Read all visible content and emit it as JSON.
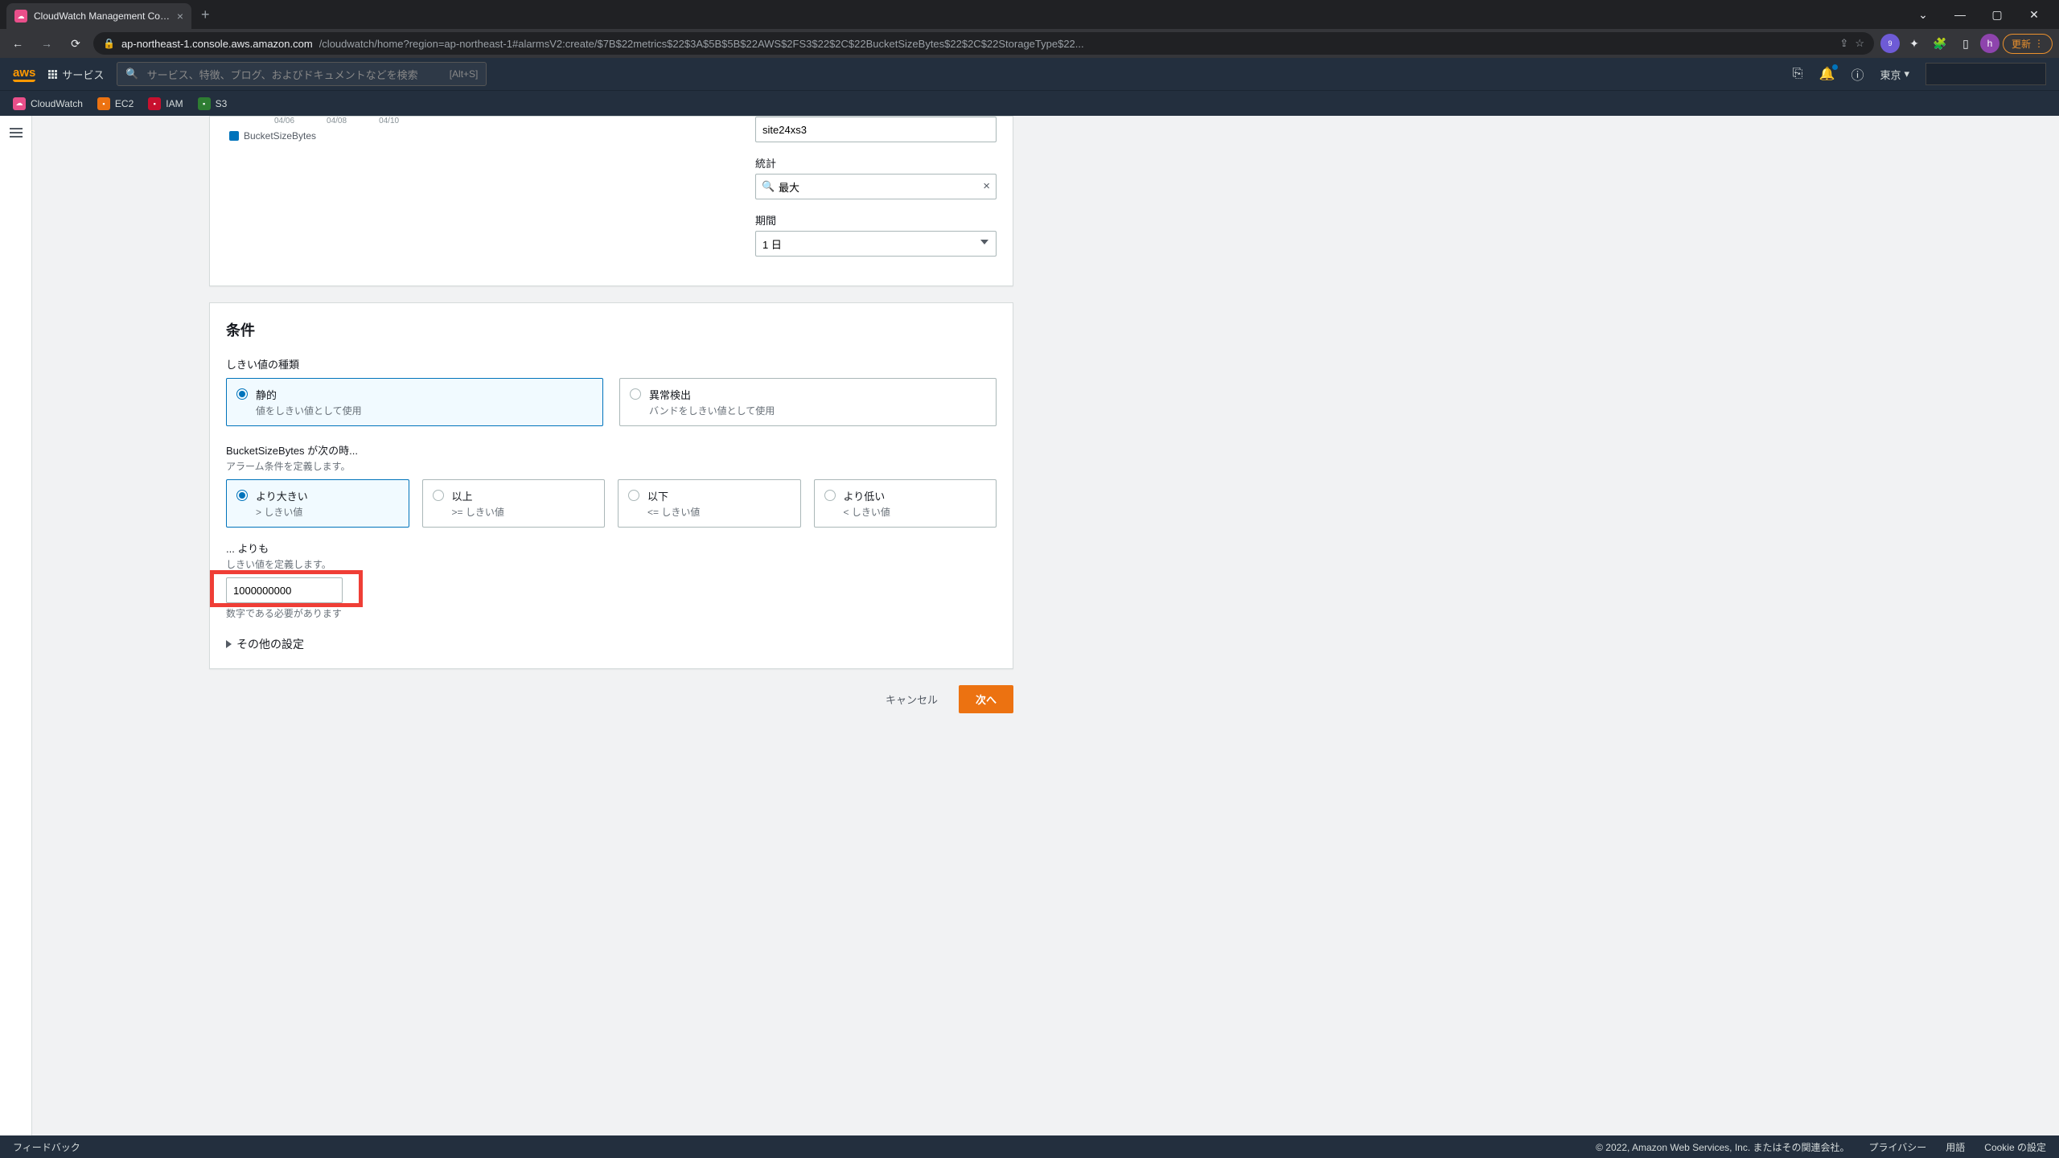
{
  "browser": {
    "tab_title": "CloudWatch Management Conso",
    "url_domain": "ap-northeast-1.console.aws.amazon.com",
    "url_path": "/cloudwatch/home?region=ap-northeast-1#alarmsV2:create/$7B$22metrics$22$3A$5B$5B$22AWS$2FS3$22$2C$22BucketSizeBytes$22$2C$22StorageType$22...",
    "avatar_letter": "h",
    "update_label": "更新",
    "ext_badge": "9"
  },
  "aws_header": {
    "logo": "aws",
    "services": "サービス",
    "search_placeholder": "サービス、特徴、ブログ、およびドキュメントなどを検索",
    "search_hint": "[Alt+S]",
    "region": "東京"
  },
  "bookmarks": [
    {
      "label": "CloudWatch",
      "cls": "bm-cw"
    },
    {
      "label": "EC2",
      "cls": "bm-ec2"
    },
    {
      "label": "IAM",
      "cls": "bm-iam"
    },
    {
      "label": "S3",
      "cls": "bm-s3"
    }
  ],
  "chart": {
    "dates": [
      "04/06",
      "04/08",
      "04/10"
    ],
    "legend": "BucketSizeBytes",
    "metric_name_value": "site24xs3",
    "stat_label": "統計",
    "stat_value": "最大",
    "period_label": "期間",
    "period_value": "1 日"
  },
  "conditions": {
    "heading": "条件",
    "threshold_type_label": "しきい値の種類",
    "tiles_type": [
      {
        "title": "静的",
        "desc": "値をしきい値として使用",
        "selected": true
      },
      {
        "title": "異常検出",
        "desc": "バンドをしきい値として使用",
        "selected": false
      }
    ],
    "when_label": "BucketSizeBytes が次の時...",
    "when_desc": "アラーム条件を定義します。",
    "tiles_op": [
      {
        "title": "より大きい",
        "desc": "> しきい値",
        "selected": true
      },
      {
        "title": "以上",
        "desc": ">= しきい値",
        "selected": false
      },
      {
        "title": "以下",
        "desc": "<= しきい値",
        "selected": false
      },
      {
        "title": "より低い",
        "desc": "< しきい値",
        "selected": false
      }
    ],
    "than_label": "... よりも",
    "than_desc": "しきい値を定義します。",
    "threshold_value": "1000000000",
    "threshold_hint": "数字である必要があります",
    "additional": "その他の設定"
  },
  "actions": {
    "cancel": "キャンセル",
    "next": "次へ"
  },
  "footer": {
    "feedback": "フィードバック",
    "copyright": "© 2022, Amazon Web Services, Inc. またはその関連会社。",
    "privacy": "プライバシー",
    "terms": "用語",
    "cookie": "Cookie の設定"
  }
}
